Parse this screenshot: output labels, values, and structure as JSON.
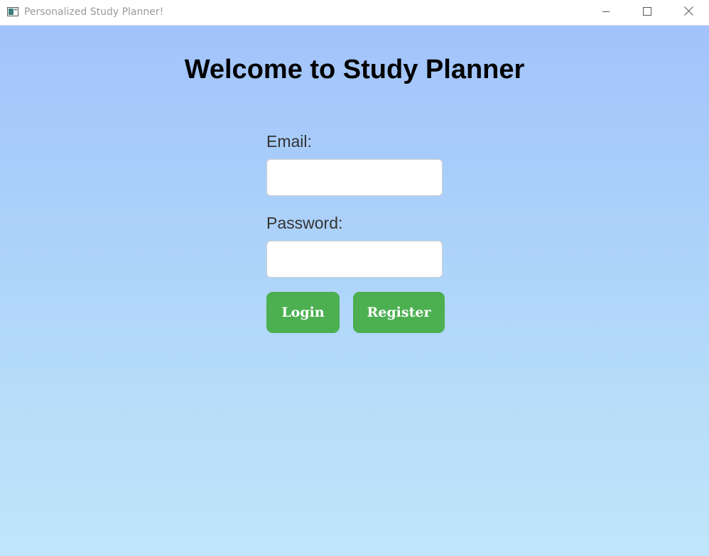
{
  "window": {
    "title": "Personalized Study Planner!",
    "icon": "app-window-icon",
    "controls": {
      "minimize": "minimize-icon",
      "maximize": "maximize-icon",
      "close": "close-icon"
    }
  },
  "page": {
    "heading": "Welcome to Study Planner",
    "email": {
      "label": "Email:",
      "value": "",
      "placeholder": ""
    },
    "password": {
      "label": "Password:",
      "value": "",
      "placeholder": ""
    },
    "buttons": {
      "login": "Login",
      "register": "Register"
    }
  },
  "colors": {
    "background_top": "#a2c3fb",
    "background_bottom": "#bfe6fa",
    "button": "#4caf50",
    "button_text": "#ffffff",
    "label_text": "#333333",
    "heading_text": "#000000"
  }
}
